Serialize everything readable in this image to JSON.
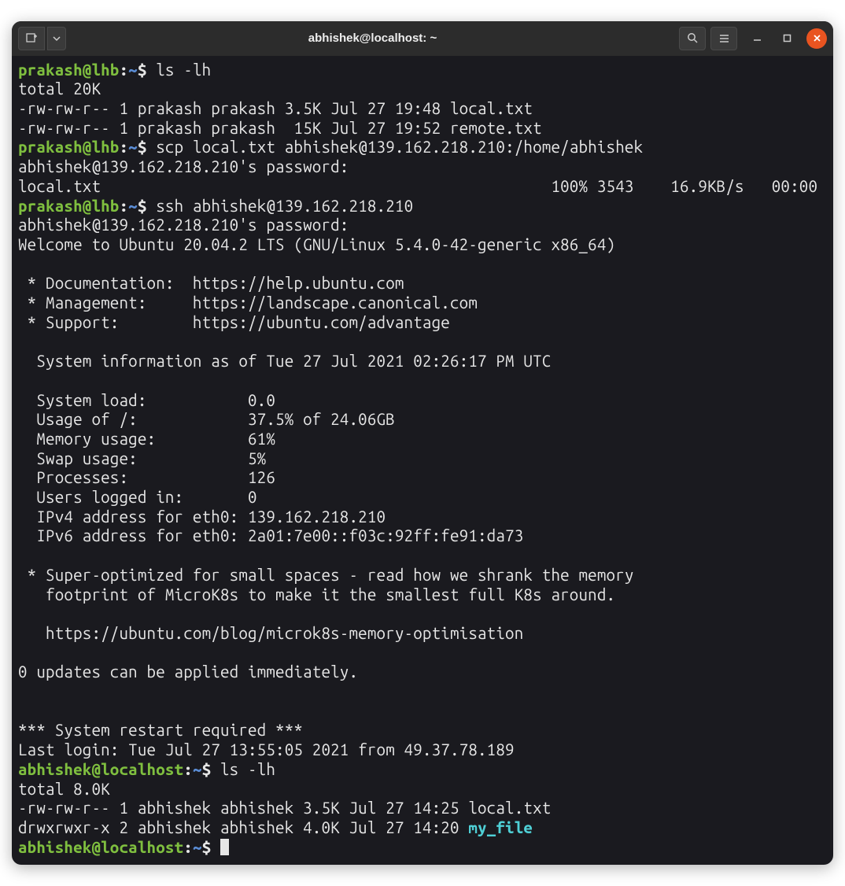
{
  "window": {
    "title": "abhishek@localhost: ~"
  },
  "prompts": {
    "p1_user": "prakash@lhb",
    "p1_path": "~",
    "p1_cmd": "ls -lh",
    "p2_user": "prakash@lhb",
    "p2_path": "~",
    "p2_cmd": "scp local.txt abhishek@139.162.218.210:/home/abhishek",
    "p3_user": "prakash@lhb",
    "p3_path": "~",
    "p3_cmd": "ssh abhishek@139.162.218.210",
    "p4_user": "abhishek@localhost",
    "p4_path": "~",
    "p4_cmd": "ls -lh",
    "p5_user": "abhishek@localhost",
    "p5_path": "~"
  },
  "lines": {
    "ls1_total": "total 20K",
    "ls1_f1": "-rw-rw-r-- 1 prakash prakash 3.5K Jul 27 19:48 local.txt",
    "ls1_f2": "-rw-rw-r-- 1 prakash prakash  15K Jul 27 19:52 remote.txt",
    "pw1": "abhishek@139.162.218.210's password:",
    "scp_progress": "local.txt                                                 100% 3543    16.9KB/s   00:00",
    "pw2": "abhishek@139.162.218.210's password:",
    "welcome": "Welcome to Ubuntu 20.04.2 LTS (GNU/Linux 5.4.0-42-generic x86_64)",
    "doc": " * Documentation:  https://help.ubuntu.com",
    "mgmt": " * Management:     https://landscape.canonical.com",
    "support": " * Support:        https://ubuntu.com/advantage",
    "sysinfo_hdr": "  System information as of Tue 27 Jul 2021 02:26:17 PM UTC",
    "sys_load": "  System load:           0.0",
    "sys_disk": "  Usage of /:            37.5% of 24.06GB",
    "sys_mem": "  Memory usage:          61%",
    "sys_swap": "  Swap usage:            5%",
    "sys_proc": "  Processes:             126",
    "sys_users": "  Users logged in:       0",
    "sys_ipv4": "  IPv4 address for eth0: 139.162.218.210",
    "sys_ipv6": "  IPv6 address for eth0: 2a01:7e00::f03c:92ff:fe91:da73",
    "micro1": " * Super-optimized for small spaces - read how we shrank the memory",
    "micro2": "   footprint of MicroK8s to make it the smallest full K8s around.",
    "micro3": "   https://ubuntu.com/blog/microk8s-memory-optimisation",
    "updates": "0 updates can be applied immediately.",
    "restart": "*** System restart required ***",
    "lastlogin": "Last login: Tue Jul 27 13:55:05 2021 from 49.37.78.189",
    "ls2_total": "total 8.0K",
    "ls2_f1": "-rw-rw-r-- 1 abhishek abhishek 3.5K Jul 27 14:25 local.txt",
    "ls2_f2_pre": "drwxrwxr-x 2 abhishek abhishek 4.0K Jul 27 14:20 ",
    "ls2_f2_dir": "my_file"
  }
}
